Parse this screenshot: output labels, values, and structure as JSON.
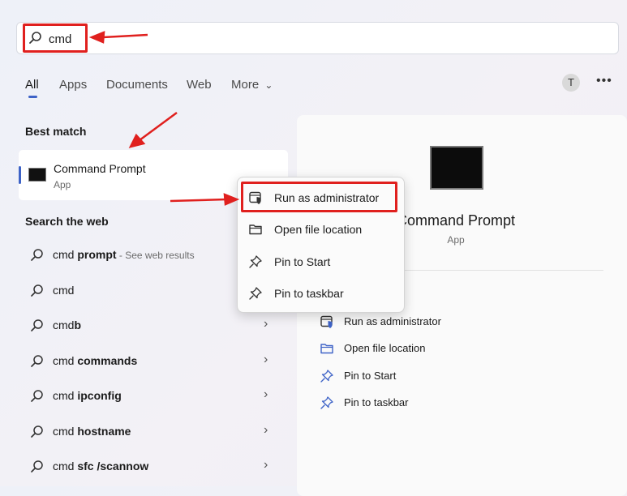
{
  "search": {
    "query": "cmd"
  },
  "tabs": [
    {
      "label": "All"
    },
    {
      "label": "Apps"
    },
    {
      "label": "Documents"
    },
    {
      "label": "Web"
    },
    {
      "label": "More"
    }
  ],
  "header": {
    "avatar_initial": "T",
    "more_menu": "•••",
    "more_tab_chevron": "⌄"
  },
  "best_match": {
    "title": "Best match",
    "name": "Command Prompt",
    "type": "App"
  },
  "web": {
    "title": "Search the web",
    "rows": [
      {
        "base": "cmd ",
        "bold": "prompt",
        "sub": " - See web results",
        "chevron": false
      },
      {
        "base": "cmd",
        "bold": "",
        "sub": "",
        "chevron": true
      },
      {
        "base": "cmd",
        "bold": "b",
        "sub": "",
        "chevron": true
      },
      {
        "base": "cmd ",
        "bold": "commands",
        "sub": "",
        "chevron": true
      },
      {
        "base": "cmd ",
        "bold": "ipconfig",
        "sub": "",
        "chevron": true
      },
      {
        "base": "cmd ",
        "bold": "hostname",
        "sub": "",
        "chevron": true
      },
      {
        "base": "cmd ",
        "bold": "sfc /scannow",
        "sub": "",
        "chevron": true
      }
    ]
  },
  "detail": {
    "name": "Command Prompt",
    "type": "App",
    "actions": [
      {
        "label": "Run as administrator",
        "icon": "shield-window-icon"
      },
      {
        "label": "Open file location",
        "icon": "folder-icon"
      },
      {
        "label": "Pin to Start",
        "icon": "pin-icon"
      },
      {
        "label": "Pin to taskbar",
        "icon": "pin-icon"
      }
    ]
  },
  "context_menu": {
    "items": [
      {
        "label": "Run as administrator",
        "icon": "shield-window-icon"
      },
      {
        "label": "Open file location",
        "icon": "folder-icon"
      },
      {
        "label": "Pin to Start",
        "icon": "pin-icon"
      },
      {
        "label": "Pin to taskbar",
        "icon": "pin-icon"
      }
    ]
  },
  "colors": {
    "accent": "#3e63c7",
    "highlight": "#e0201e"
  }
}
